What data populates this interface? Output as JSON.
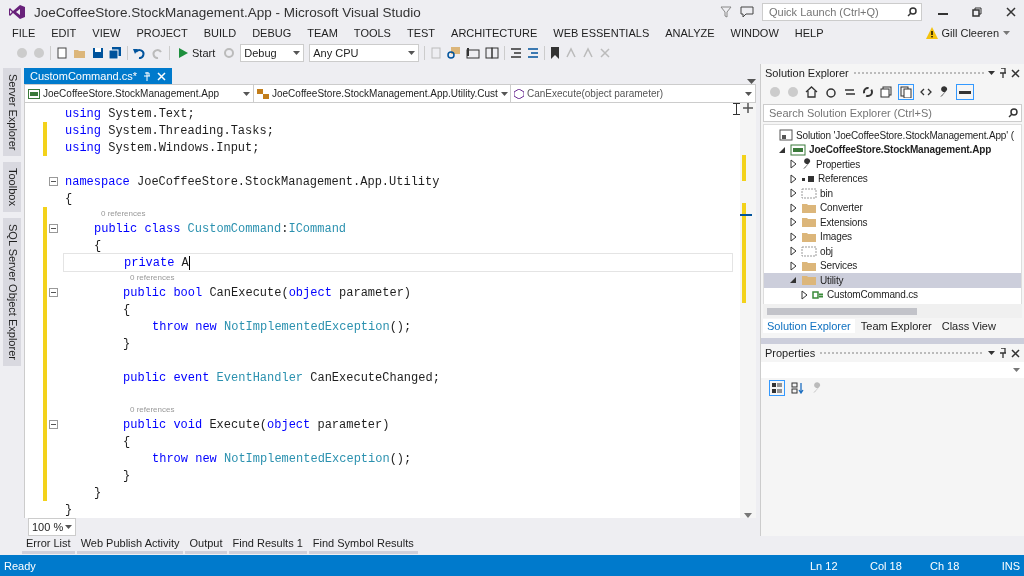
{
  "window": {
    "title": "JoeCoffeeStore.StockManagement.App - Microsoft Visual Studio"
  },
  "quick_launch": {
    "placeholder": "Quick Launch (Ctrl+Q)"
  },
  "user": {
    "name": "Gill Cleeren"
  },
  "menu": [
    "FILE",
    "EDIT",
    "VIEW",
    "PROJECT",
    "BUILD",
    "DEBUG",
    "TEAM",
    "TOOLS",
    "TEST",
    "ARCHITECTURE",
    "WEB ESSENTIALS",
    "ANALYZE",
    "WINDOW",
    "HELP"
  ],
  "toolbar": {
    "start": "Start",
    "configuration": "Debug",
    "platform": "Any CPU"
  },
  "side_tabs": [
    "Server Explorer",
    "Toolbox",
    "SQL Server Object Explorer"
  ],
  "editor": {
    "tabs": [
      {
        "label": "CustomCommand.cs*",
        "selected": true
      }
    ],
    "nav": [
      "JoeCoffeeStore.StockManagement.App",
      "JoeCoffeeStore.StockManagement.App.Utility.Cust",
      "CanExecute(object parameter)"
    ],
    "lines": [
      {
        "kind": "code",
        "changed": false,
        "fold": false,
        "current": false,
        "tokens": [
          {
            "kind": "keyword",
            "text": "using"
          },
          {
            "kind": "plain",
            "text": " System.Text;"
          }
        ]
      },
      {
        "kind": "code",
        "changed": true,
        "fold": false,
        "current": false,
        "tokens": [
          {
            "kind": "keyword",
            "text": "using"
          },
          {
            "kind": "plain",
            "text": " System.Threading.Tasks;"
          }
        ]
      },
      {
        "kind": "code",
        "changed": true,
        "fold": false,
        "current": false,
        "tokens": [
          {
            "kind": "keyword",
            "text": "using"
          },
          {
            "kind": "plain",
            "text": " System.Windows.Input;"
          }
        ]
      },
      {
        "kind": "blank",
        "changed": false
      },
      {
        "kind": "code",
        "changed": false,
        "fold": true,
        "current": false,
        "tokens": [
          {
            "kind": "keyword",
            "text": "namespace"
          },
          {
            "kind": "plain",
            "text": " JoeCoffeeStore.StockManagement.App.Utility"
          }
        ]
      },
      {
        "kind": "code",
        "changed": false,
        "fold": false,
        "current": false,
        "tokens": [
          {
            "kind": "plain",
            "text": "{"
          }
        ]
      },
      {
        "kind": "block",
        "children": [
          {
            "kind": "lens",
            "changed": true,
            "text": "0 references"
          },
          {
            "kind": "code",
            "changed": true,
            "fold": true,
            "current": false,
            "tokens": [
              {
                "kind": "keyword",
                "text": "public class"
              },
              {
                "kind": "type",
                "text": " CustomCommand"
              },
              {
                "kind": "plain",
                "text": ":"
              },
              {
                "kind": "type",
                "text": "ICommand"
              }
            ]
          },
          {
            "kind": "code",
            "changed": true,
            "fold": false,
            "current": false,
            "tokens": [
              {
                "kind": "plain",
                "text": "{"
              }
            ]
          },
          {
            "kind": "block",
            "children": [
              {
                "kind": "code",
                "changed": true,
                "fold": false,
                "current": true,
                "tokens": [
                  {
                    "kind": "keyword",
                    "text": "private"
                  },
                  {
                    "kind": "plain",
                    "text": " A"
                  }
                ]
              },
              {
                "kind": "lens",
                "changed": true,
                "text": "0 references"
              },
              {
                "kind": "code",
                "changed": true,
                "fold": true,
                "current": false,
                "tokens": [
                  {
                    "kind": "keyword",
                    "text": "public bool"
                  },
                  {
                    "kind": "plain",
                    "text": " CanExecute("
                  },
                  {
                    "kind": "keyword",
                    "text": "object"
                  },
                  {
                    "kind": "plain",
                    "text": " parameter)"
                  }
                ]
              },
              {
                "kind": "code",
                "changed": true,
                "fold": false,
                "current": false,
                "tokens": [
                  {
                    "kind": "plain",
                    "text": "{"
                  }
                ]
              },
              {
                "kind": "block",
                "children": [
                  {
                    "kind": "code",
                    "changed": true,
                    "fold": false,
                    "current": false,
                    "tokens": [
                      {
                        "kind": "keyword",
                        "text": "throw new"
                      },
                      {
                        "kind": "type",
                        "text": " NotImplementedException"
                      },
                      {
                        "kind": "plain",
                        "text": "();"
                      }
                    ]
                  }
                ]
              },
              {
                "kind": "code",
                "changed": true,
                "fold": false,
                "current": false,
                "tokens": [
                  {
                    "kind": "plain",
                    "text": "}"
                  }
                ]
              },
              {
                "kind": "blank",
                "changed": true
              },
              {
                "kind": "code",
                "changed": true,
                "fold": false,
                "current": false,
                "tokens": [
                  {
                    "kind": "keyword",
                    "text": "public event"
                  },
                  {
                    "kind": "type",
                    "text": " EventHandler"
                  },
                  {
                    "kind": "plain",
                    "text": " CanExecuteChanged;"
                  }
                ]
              },
              {
                "kind": "blank",
                "changed": true
              },
              {
                "kind": "lens",
                "changed": true,
                "text": "0 references"
              },
              {
                "kind": "code",
                "changed": true,
                "fold": true,
                "current": false,
                "tokens": [
                  {
                    "kind": "keyword",
                    "text": "public void"
                  },
                  {
                    "kind": "plain",
                    "text": " Execute("
                  },
                  {
                    "kind": "keyword",
                    "text": "object"
                  },
                  {
                    "kind": "plain",
                    "text": " parameter)"
                  }
                ]
              },
              {
                "kind": "code",
                "changed": true,
                "fold": false,
                "current": false,
                "tokens": [
                  {
                    "kind": "plain",
                    "text": "{"
                  }
                ]
              },
              {
                "kind": "block",
                "children": [
                  {
                    "kind": "code",
                    "changed": true,
                    "fold": false,
                    "current": false,
                    "tokens": [
                      {
                        "kind": "keyword",
                        "text": "throw new"
                      },
                      {
                        "kind": "type",
                        "text": " NotImplementedException"
                      },
                      {
                        "kind": "plain",
                        "text": "();"
                      }
                    ]
                  }
                ]
              },
              {
                "kind": "code",
                "changed": true,
                "fold": false,
                "current": false,
                "tokens": [
                  {
                    "kind": "plain",
                    "text": "}"
                  }
                ]
              }
            ]
          },
          {
            "kind": "code",
            "changed": true,
            "fold": false,
            "current": false,
            "tokens": [
              {
                "kind": "plain",
                "text": "}"
              }
            ]
          }
        ]
      },
      {
        "kind": "code",
        "changed": false,
        "fold": false,
        "current": false,
        "tokens": [
          {
            "kind": "plain",
            "text": "}"
          }
        ]
      }
    ],
    "zoom": "100 %"
  },
  "solution_explorer": {
    "title": "Solution Explorer",
    "search": {
      "placeholder": "Search Solution Explorer (Ctrl+S)"
    },
    "tree": [
      {
        "label": "Solution 'JoeCoffeeStore.StockManagement.App' (",
        "kind": "solution",
        "selected": false,
        "children": [
          {
            "label": "JoeCoffeeStore.StockManagement.App",
            "kind": "project",
            "expanded": true,
            "selected": false,
            "children": [
              {
                "label": "Properties",
                "kind": "properties",
                "expanded": false,
                "selected": false
              },
              {
                "label": "References",
                "kind": "references",
                "expanded": false,
                "selected": false
              },
              {
                "label": "bin",
                "kind": "hidden-folder",
                "expanded": false,
                "selected": false
              },
              {
                "label": "Converter",
                "kind": "folder",
                "expanded": false,
                "selected": false
              },
              {
                "label": "Extensions",
                "kind": "folder",
                "expanded": false,
                "selected": false
              },
              {
                "label": "Images",
                "kind": "folder",
                "expanded": false,
                "selected": false
              },
              {
                "label": "obj",
                "kind": "hidden-folder",
                "expanded": false,
                "selected": false
              },
              {
                "label": "Services",
                "kind": "folder",
                "expanded": false,
                "selected": false
              },
              {
                "label": "Utility",
                "kind": "folder",
                "expanded": true,
                "selected": true,
                "children": [
                  {
                    "label": "CustomCommand.cs",
                    "kind": "csharp",
                    "expanded": false,
                    "selected": false
                  }
                ]
              }
            ]
          }
        ]
      }
    ],
    "tabs": [
      {
        "label": "Solution Explorer",
        "selected": true
      },
      {
        "label": "Team Explorer",
        "selected": false
      },
      {
        "label": "Class View",
        "selected": false
      }
    ]
  },
  "properties": {
    "title": "Properties"
  },
  "output_tabs": [
    "Error List",
    "Web Publish Activity",
    "Output",
    "Find Results 1",
    "Find Symbol Results"
  ],
  "status_bar": {
    "message": "Ready",
    "line": "Ln 12",
    "column": "Col 18",
    "char": "Ch 18",
    "mode": "INS"
  }
}
